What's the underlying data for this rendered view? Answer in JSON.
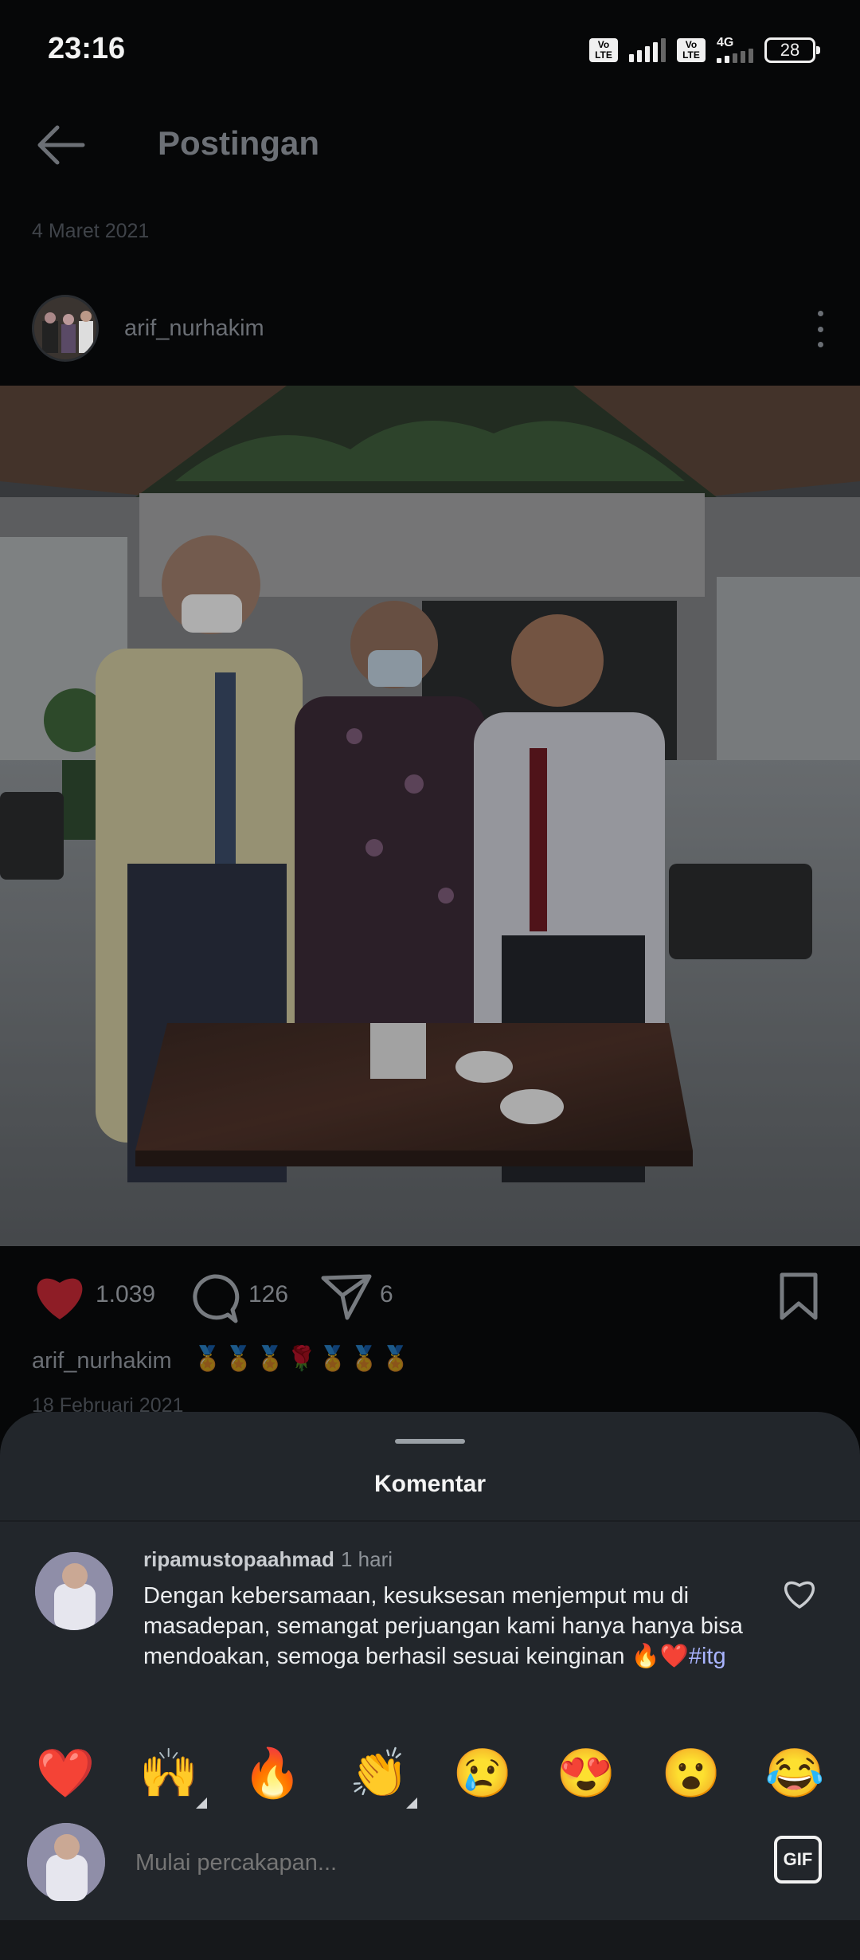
{
  "status_bar": {
    "time": "23:16",
    "volte1": "Vo LTE",
    "volte2": "Vo LTE",
    "network": "4G",
    "battery": "28"
  },
  "header": {
    "title": "Postingan",
    "back_icon": "arrow-left-icon"
  },
  "post": {
    "date": "4 Maret 2021",
    "username": "arif_nurhakim",
    "more_icon": "more-vertical-icon",
    "likes": "1.039",
    "comments": "126",
    "shares": "6",
    "caption_user": "arif_nurhakim",
    "caption_text": "🏅🏅🏅🌹🏅🏅🏅",
    "caption_date": "18 Februari 2021"
  },
  "comments_sheet": {
    "title": "Komentar",
    "comment": {
      "username": "ripamustopaahmad",
      "time": "1 hari",
      "text": "Dengan kebersamaan, kesuksesan menjemput mu di masadepan, semangat perjuangan kami hanya hanya bisa mendoakan, semoga berhasil sesuai keinginan 🔥❤️",
      "hashtag": "#itg"
    },
    "quick_reactions": [
      "❤️",
      "🙌",
      "🔥",
      "👏",
      "😢",
      "😍",
      "😮",
      "😂"
    ],
    "input_placeholder": "Mulai percakapan...",
    "gif_label": "GIF"
  },
  "colors": {
    "background": "#060708",
    "sheet": "#22262b",
    "like_red": "#c0232f",
    "hashtag": "#a9b4ff"
  }
}
